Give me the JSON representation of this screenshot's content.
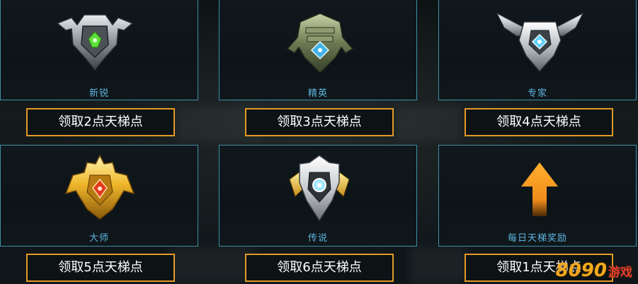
{
  "ranks": [
    {
      "name": "新锐",
      "button": "领取2点天梯点",
      "badge_icon": "rookie-rank-badge-icon"
    },
    {
      "name": "精英",
      "button": "领取3点天梯点",
      "badge_icon": "elite-rank-badge-icon"
    },
    {
      "name": "专家",
      "button": "领取4点天梯点",
      "badge_icon": "expert-rank-badge-icon"
    },
    {
      "name": "大师",
      "button": "领取5点天梯点",
      "badge_icon": "master-rank-badge-icon"
    },
    {
      "name": "传说",
      "button": "领取6点天梯点",
      "badge_icon": "legend-rank-badge-icon"
    },
    {
      "name": "每日天梯奖励",
      "button": "领取1点天梯点",
      "badge_icon": "orange-up-arrow-icon"
    }
  ],
  "watermark": {
    "number": "8090",
    "text": "游戏"
  },
  "colors": {
    "card_border": "#3e8fa6",
    "label_text": "#5fb5e0",
    "button_border": "#e49a25",
    "button_text": "#ffffff",
    "arrow": "#f08c1a"
  }
}
